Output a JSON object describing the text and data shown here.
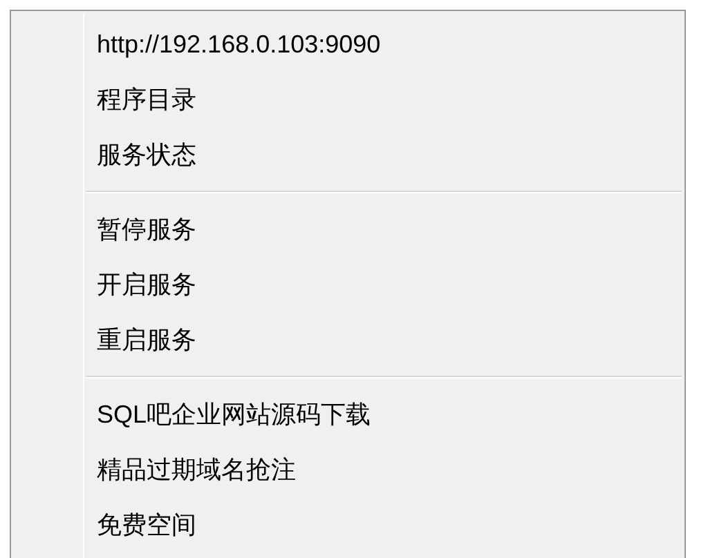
{
  "context_menu": {
    "items": [
      {
        "kind": "item",
        "label": "http://192.168.0.103:9090"
      },
      {
        "kind": "item",
        "label": "程序目录"
      },
      {
        "kind": "item",
        "label": "服务状态"
      },
      {
        "kind": "separator"
      },
      {
        "kind": "item",
        "label": "暂停服务"
      },
      {
        "kind": "item",
        "label": "开启服务"
      },
      {
        "kind": "item",
        "label": "重启服务"
      },
      {
        "kind": "separator"
      },
      {
        "kind": "item",
        "label": "SQL吧企业网站源码下载"
      },
      {
        "kind": "item",
        "label": "精品过期域名抢注"
      },
      {
        "kind": "item",
        "label": "免费空间"
      }
    ]
  }
}
